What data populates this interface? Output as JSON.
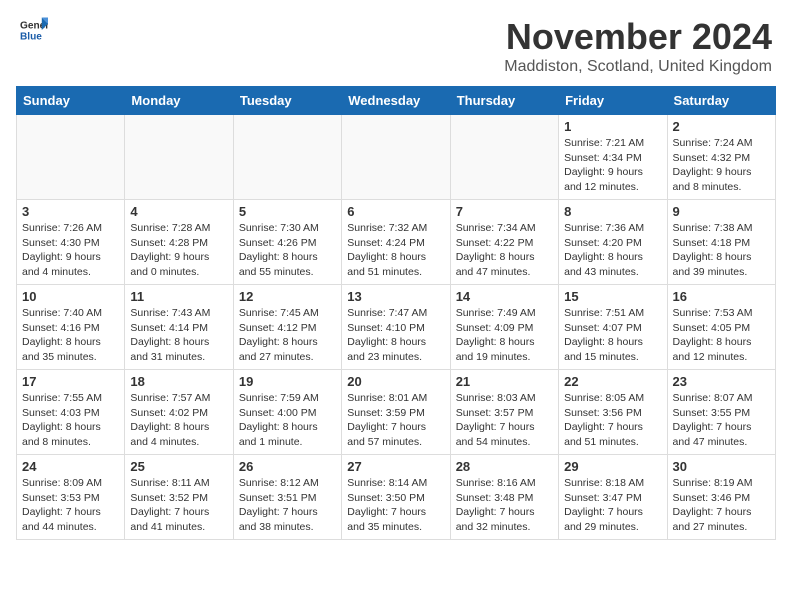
{
  "header": {
    "logo_general": "General",
    "logo_blue": "Blue",
    "month_title": "November 2024",
    "location": "Maddiston, Scotland, United Kingdom"
  },
  "weekdays": [
    "Sunday",
    "Monday",
    "Tuesday",
    "Wednesday",
    "Thursday",
    "Friday",
    "Saturday"
  ],
  "weeks": [
    [
      {
        "day": "",
        "sunrise": "",
        "sunset": "",
        "daylight": "",
        "empty": true
      },
      {
        "day": "",
        "sunrise": "",
        "sunset": "",
        "daylight": "",
        "empty": true
      },
      {
        "day": "",
        "sunrise": "",
        "sunset": "",
        "daylight": "",
        "empty": true
      },
      {
        "day": "",
        "sunrise": "",
        "sunset": "",
        "daylight": "",
        "empty": true
      },
      {
        "day": "",
        "sunrise": "",
        "sunset": "",
        "daylight": "",
        "empty": true
      },
      {
        "day": "1",
        "sunrise": "Sunrise: 7:21 AM",
        "sunset": "Sunset: 4:34 PM",
        "daylight": "Daylight: 9 hours and 12 minutes.",
        "empty": false
      },
      {
        "day": "2",
        "sunrise": "Sunrise: 7:24 AM",
        "sunset": "Sunset: 4:32 PM",
        "daylight": "Daylight: 9 hours and 8 minutes.",
        "empty": false
      }
    ],
    [
      {
        "day": "3",
        "sunrise": "Sunrise: 7:26 AM",
        "sunset": "Sunset: 4:30 PM",
        "daylight": "Daylight: 9 hours and 4 minutes.",
        "empty": false
      },
      {
        "day": "4",
        "sunrise": "Sunrise: 7:28 AM",
        "sunset": "Sunset: 4:28 PM",
        "daylight": "Daylight: 9 hours and 0 minutes.",
        "empty": false
      },
      {
        "day": "5",
        "sunrise": "Sunrise: 7:30 AM",
        "sunset": "Sunset: 4:26 PM",
        "daylight": "Daylight: 8 hours and 55 minutes.",
        "empty": false
      },
      {
        "day": "6",
        "sunrise": "Sunrise: 7:32 AM",
        "sunset": "Sunset: 4:24 PM",
        "daylight": "Daylight: 8 hours and 51 minutes.",
        "empty": false
      },
      {
        "day": "7",
        "sunrise": "Sunrise: 7:34 AM",
        "sunset": "Sunset: 4:22 PM",
        "daylight": "Daylight: 8 hours and 47 minutes.",
        "empty": false
      },
      {
        "day": "8",
        "sunrise": "Sunrise: 7:36 AM",
        "sunset": "Sunset: 4:20 PM",
        "daylight": "Daylight: 8 hours and 43 minutes.",
        "empty": false
      },
      {
        "day": "9",
        "sunrise": "Sunrise: 7:38 AM",
        "sunset": "Sunset: 4:18 PM",
        "daylight": "Daylight: 8 hours and 39 minutes.",
        "empty": false
      }
    ],
    [
      {
        "day": "10",
        "sunrise": "Sunrise: 7:40 AM",
        "sunset": "Sunset: 4:16 PM",
        "daylight": "Daylight: 8 hours and 35 minutes.",
        "empty": false
      },
      {
        "day": "11",
        "sunrise": "Sunrise: 7:43 AM",
        "sunset": "Sunset: 4:14 PM",
        "daylight": "Daylight: 8 hours and 31 minutes.",
        "empty": false
      },
      {
        "day": "12",
        "sunrise": "Sunrise: 7:45 AM",
        "sunset": "Sunset: 4:12 PM",
        "daylight": "Daylight: 8 hours and 27 minutes.",
        "empty": false
      },
      {
        "day": "13",
        "sunrise": "Sunrise: 7:47 AM",
        "sunset": "Sunset: 4:10 PM",
        "daylight": "Daylight: 8 hours and 23 minutes.",
        "empty": false
      },
      {
        "day": "14",
        "sunrise": "Sunrise: 7:49 AM",
        "sunset": "Sunset: 4:09 PM",
        "daylight": "Daylight: 8 hours and 19 minutes.",
        "empty": false
      },
      {
        "day": "15",
        "sunrise": "Sunrise: 7:51 AM",
        "sunset": "Sunset: 4:07 PM",
        "daylight": "Daylight: 8 hours and 15 minutes.",
        "empty": false
      },
      {
        "day": "16",
        "sunrise": "Sunrise: 7:53 AM",
        "sunset": "Sunset: 4:05 PM",
        "daylight": "Daylight: 8 hours and 12 minutes.",
        "empty": false
      }
    ],
    [
      {
        "day": "17",
        "sunrise": "Sunrise: 7:55 AM",
        "sunset": "Sunset: 4:03 PM",
        "daylight": "Daylight: 8 hours and 8 minutes.",
        "empty": false
      },
      {
        "day": "18",
        "sunrise": "Sunrise: 7:57 AM",
        "sunset": "Sunset: 4:02 PM",
        "daylight": "Daylight: 8 hours and 4 minutes.",
        "empty": false
      },
      {
        "day": "19",
        "sunrise": "Sunrise: 7:59 AM",
        "sunset": "Sunset: 4:00 PM",
        "daylight": "Daylight: 8 hours and 1 minute.",
        "empty": false
      },
      {
        "day": "20",
        "sunrise": "Sunrise: 8:01 AM",
        "sunset": "Sunset: 3:59 PM",
        "daylight": "Daylight: 7 hours and 57 minutes.",
        "empty": false
      },
      {
        "day": "21",
        "sunrise": "Sunrise: 8:03 AM",
        "sunset": "Sunset: 3:57 PM",
        "daylight": "Daylight: 7 hours and 54 minutes.",
        "empty": false
      },
      {
        "day": "22",
        "sunrise": "Sunrise: 8:05 AM",
        "sunset": "Sunset: 3:56 PM",
        "daylight": "Daylight: 7 hours and 51 minutes.",
        "empty": false
      },
      {
        "day": "23",
        "sunrise": "Sunrise: 8:07 AM",
        "sunset": "Sunset: 3:55 PM",
        "daylight": "Daylight: 7 hours and 47 minutes.",
        "empty": false
      }
    ],
    [
      {
        "day": "24",
        "sunrise": "Sunrise: 8:09 AM",
        "sunset": "Sunset: 3:53 PM",
        "daylight": "Daylight: 7 hours and 44 minutes.",
        "empty": false
      },
      {
        "day": "25",
        "sunrise": "Sunrise: 8:11 AM",
        "sunset": "Sunset: 3:52 PM",
        "daylight": "Daylight: 7 hours and 41 minutes.",
        "empty": false
      },
      {
        "day": "26",
        "sunrise": "Sunrise: 8:12 AM",
        "sunset": "Sunset: 3:51 PM",
        "daylight": "Daylight: 7 hours and 38 minutes.",
        "empty": false
      },
      {
        "day": "27",
        "sunrise": "Sunrise: 8:14 AM",
        "sunset": "Sunset: 3:50 PM",
        "daylight": "Daylight: 7 hours and 35 minutes.",
        "empty": false
      },
      {
        "day": "28",
        "sunrise": "Sunrise: 8:16 AM",
        "sunset": "Sunset: 3:48 PM",
        "daylight": "Daylight: 7 hours and 32 minutes.",
        "empty": false
      },
      {
        "day": "29",
        "sunrise": "Sunrise: 8:18 AM",
        "sunset": "Sunset: 3:47 PM",
        "daylight": "Daylight: 7 hours and 29 minutes.",
        "empty": false
      },
      {
        "day": "30",
        "sunrise": "Sunrise: 8:19 AM",
        "sunset": "Sunset: 3:46 PM",
        "daylight": "Daylight: 7 hours and 27 minutes.",
        "empty": false
      }
    ]
  ]
}
